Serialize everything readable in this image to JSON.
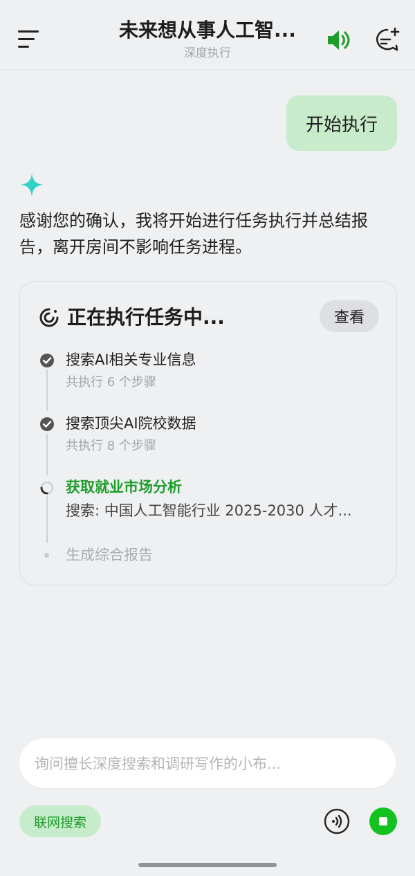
{
  "header": {
    "title": "未来想从事人工智...",
    "subtitle": "深度执行"
  },
  "user_message": "开始执行",
  "ai_message": "感谢您的确认，我将开始进行任务执行并总结报告，离开房间不影响任务进程。",
  "task_card": {
    "title": "正在执行任务中...",
    "view_label": "查看",
    "steps": [
      {
        "label": "搜索AI相关专业信息",
        "sub": "共执行 6 个步骤",
        "status": "done"
      },
      {
        "label": "搜索顶尖AI院校数据",
        "sub": "共执行 8 个步骤",
        "status": "done"
      },
      {
        "label": "获取就业市场分析",
        "sub": "搜索: 中国人工智能行业 2025-2030 人才...",
        "status": "active"
      },
      {
        "label": "生成综合报告",
        "sub": "",
        "status": "pending"
      }
    ]
  },
  "input": {
    "placeholder": "询问擅长深度搜索和调研写作的小布...",
    "value": ""
  },
  "bottom": {
    "web_search_label": "联网搜索"
  },
  "colors": {
    "accent_green": "#1f9d2b",
    "bubble_green": "#c8eccb",
    "background": "#eff0f2",
    "sparkle_start": "#3ee0b8",
    "sparkle_end": "#22c3d6"
  },
  "icons": {
    "menu": "menu-icon",
    "speaker": "speaker-icon",
    "new_chat": "new-chat-icon",
    "sparkle": "sparkle-icon",
    "task": "task-progress-icon",
    "check": "check-circle-icon",
    "loading": "loading-spinner-icon",
    "voice": "voice-icon",
    "stop": "stop-icon"
  }
}
